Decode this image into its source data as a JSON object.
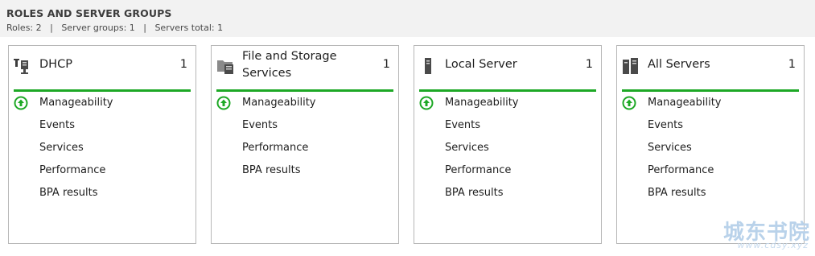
{
  "section": {
    "title": "ROLES AND SERVER GROUPS",
    "summary": "Roles: 2   |   Server groups: 1   |   Servers total: 1"
  },
  "cards": [
    {
      "title": "DHCP",
      "count": "1",
      "icon": "dhcp-role-icon",
      "rows": [
        "Manageability",
        "Events",
        "Services",
        "Performance",
        "BPA results"
      ]
    },
    {
      "title": "File and Storage Services",
      "count": "1",
      "icon": "file-storage-icon",
      "rows": [
        "Manageability",
        "Events",
        "Performance",
        "BPA results"
      ]
    },
    {
      "title": "Local Server",
      "count": "1",
      "icon": "local-server-icon",
      "rows": [
        "Manageability",
        "Events",
        "Services",
        "Performance",
        "BPA results"
      ]
    },
    {
      "title": "All Servers",
      "count": "1",
      "icon": "all-servers-icon",
      "rows": [
        "Manageability",
        "Events",
        "Services",
        "Performance",
        "BPA results"
      ]
    }
  ],
  "colors": {
    "status_ok": "#1da825",
    "card_border": "#b7b7b7",
    "header_bg": "#f2f2f2"
  },
  "watermark": {
    "main": "城东书院",
    "sub": "www.cdsy.xyz"
  }
}
